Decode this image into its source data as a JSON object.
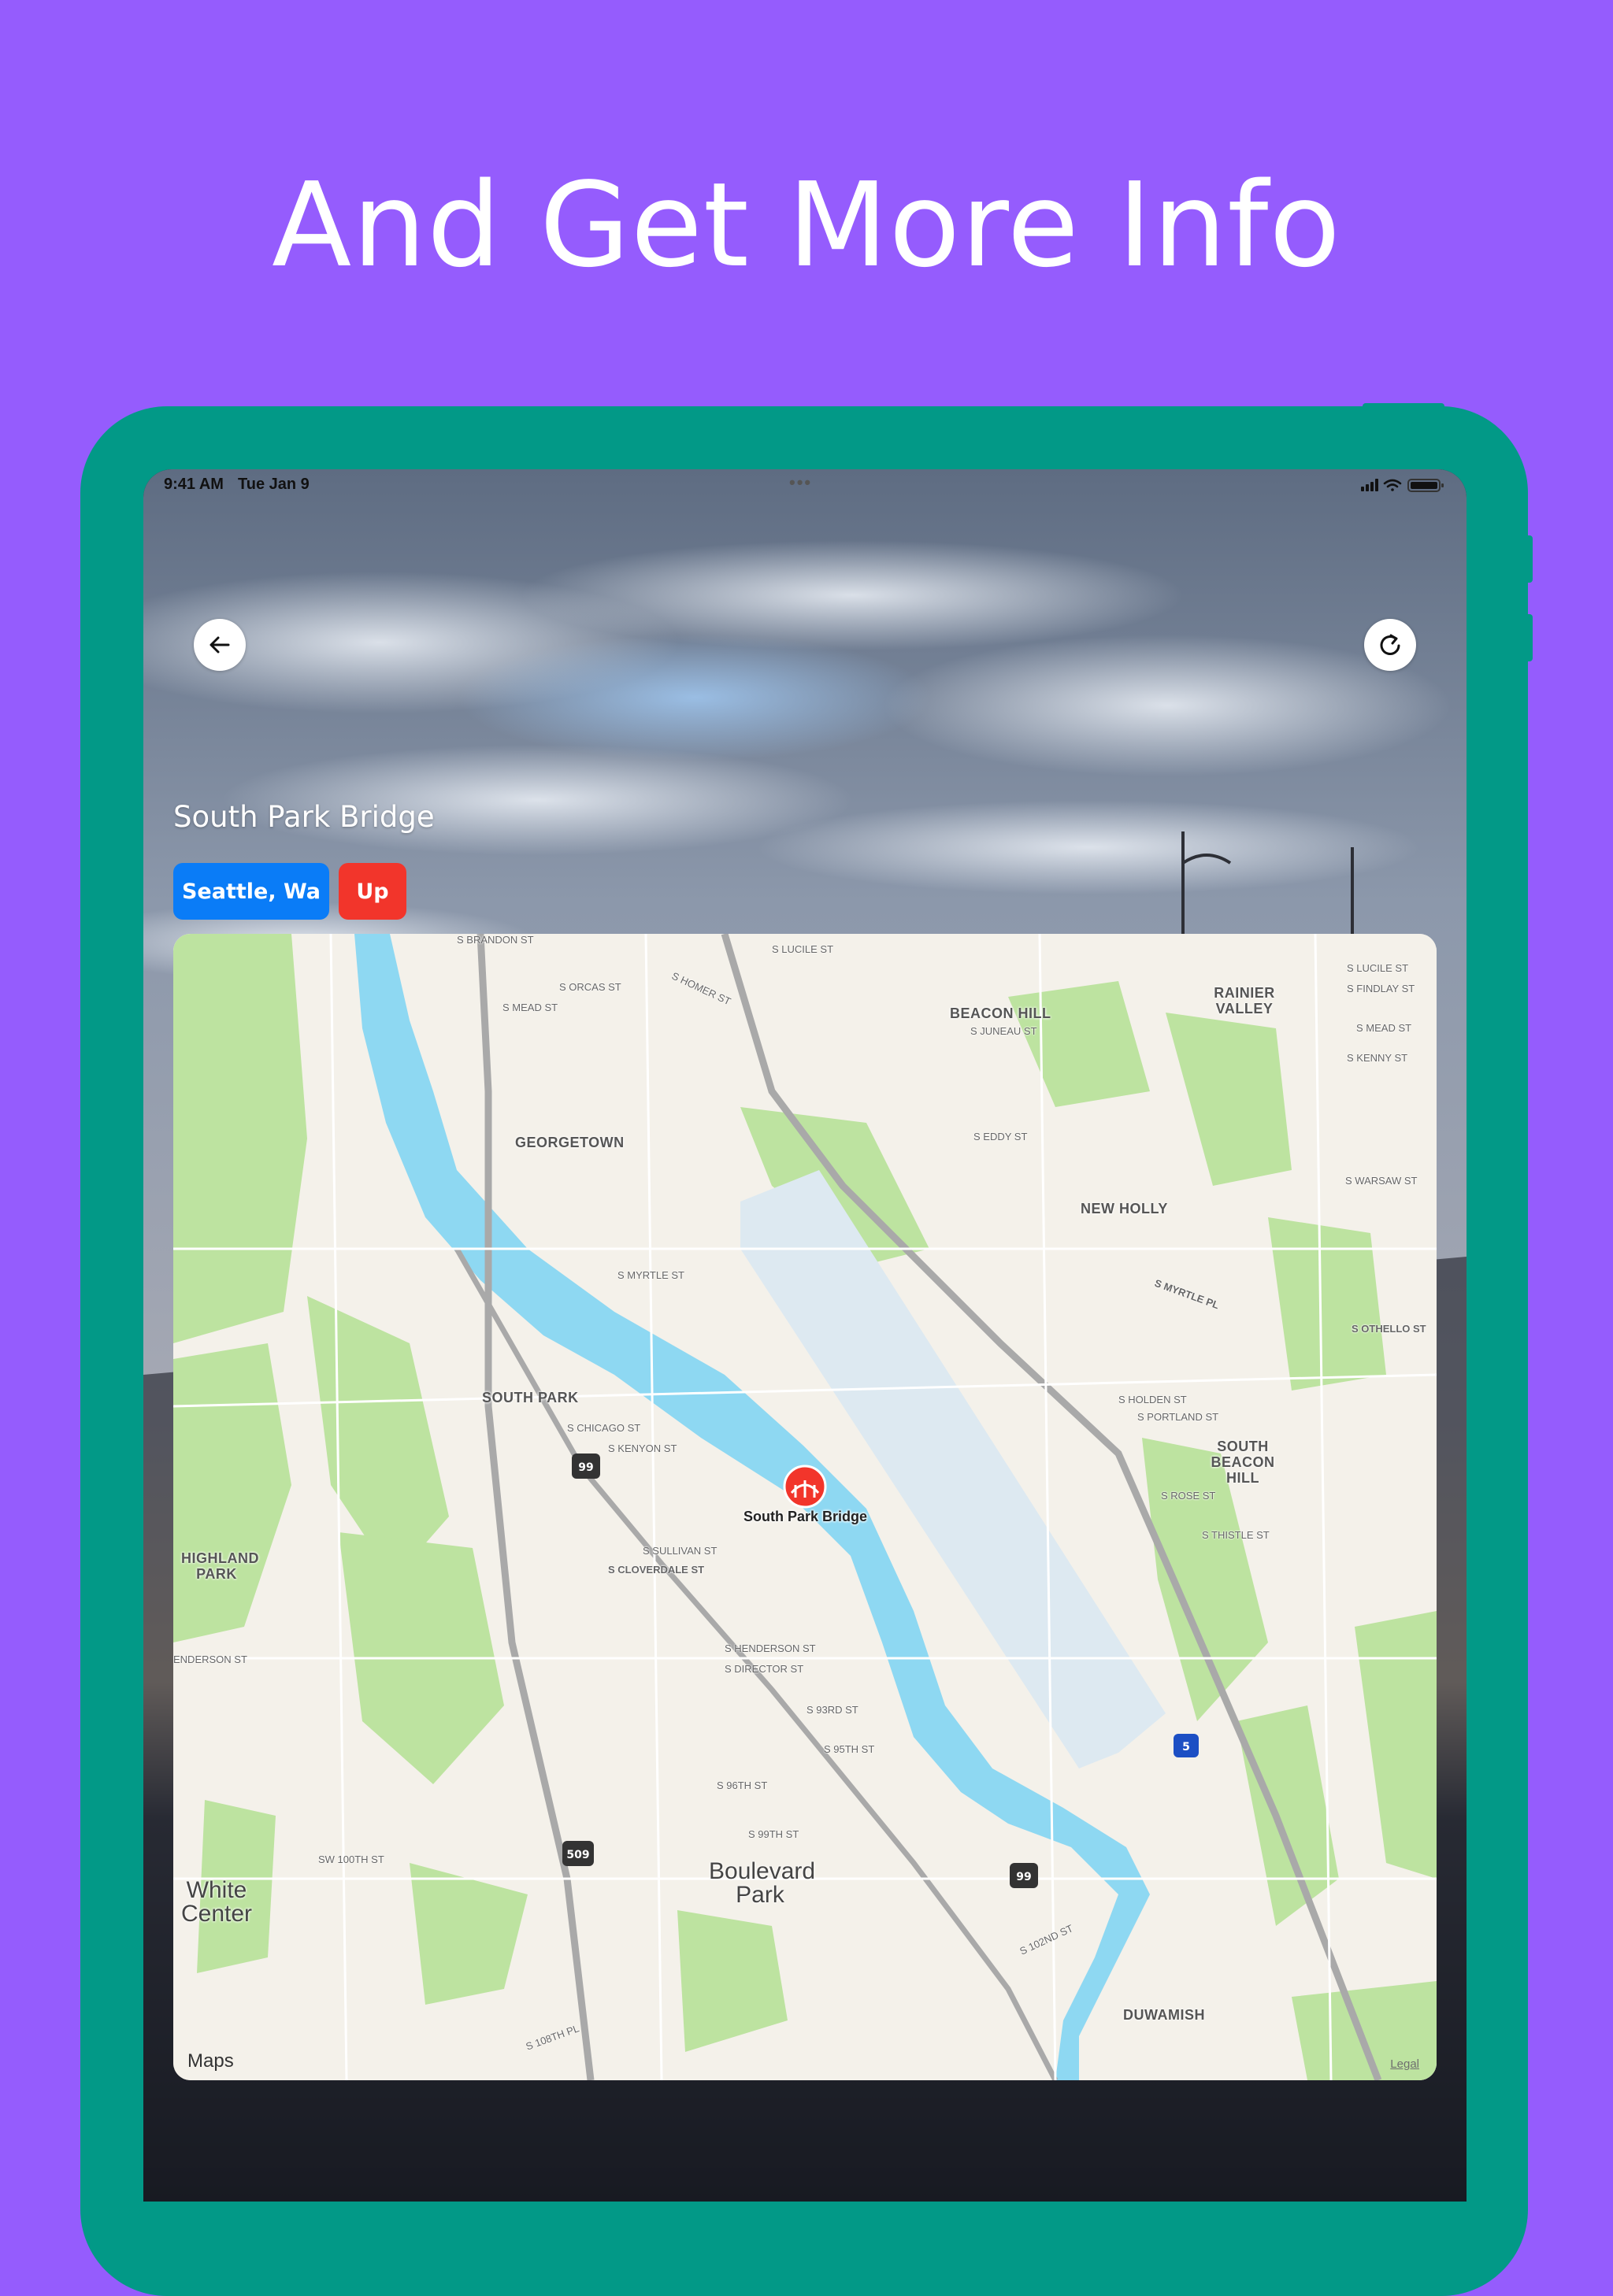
{
  "headline": "And Get More Info",
  "status_bar": {
    "time": "9:41 AM",
    "date": "Tue Jan 9"
  },
  "detail": {
    "title": "South Park Bridge",
    "chips": [
      {
        "label": "Seattle, Wa",
        "color": "#0a7cf7"
      },
      {
        "label": "Up",
        "color": "#f2352b"
      }
    ],
    "back_icon": "arrow-left-icon",
    "refresh_icon": "refresh-icon"
  },
  "map": {
    "pin_label": "South Park Bridge",
    "logo": " Maps",
    "legal": "Legal",
    "areas": [
      {
        "text": "GEORGETOWN"
      },
      {
        "text": "BEACON HILL"
      },
      {
        "text": "RAINIER VALLEY"
      },
      {
        "text": "NEW HOLLY"
      },
      {
        "text": "SOUTH PARK"
      },
      {
        "text": "SOUTH BEACON HILL"
      },
      {
        "text": "HIGHLAND PARK"
      },
      {
        "text": "DUWAMISH"
      }
    ],
    "big_places": [
      {
        "text": "Boulevard Park"
      },
      {
        "text": "White Center"
      }
    ],
    "streets": [
      "S BRANDON ST",
      "S LUCILE ST",
      "S LUCILE ST",
      "S FINDLAY ST",
      "S ORCAS ST",
      "S HOMER ST",
      "S MEAD ST",
      "S JUNEAU ST",
      "S MEAD ST",
      "S KENNY ST",
      "S EDDY ST",
      "S WARSAW ST",
      "S MYRTLE ST",
      "S MYRTLE PL",
      "S OTHELLO ST",
      "S HOLDEN ST",
      "S PORTLAND ST",
      "S CHICAGO ST",
      "S KENYON ST",
      "S ROSE ST",
      "S SULLIVAN ST",
      "S CLOVERDALE ST",
      "S THISTLE ST",
      "S HENDERSON ST",
      "S DIRECTOR ST",
      "S 93RD ST",
      "S 95TH ST",
      "S 96TH ST",
      "S 99TH ST",
      "SW 100TH ST",
      "S 102ND ST",
      "S 108TH PL",
      "ENDERSON ST"
    ],
    "highway_shields": [
      "99",
      "99",
      "509",
      "5"
    ]
  },
  "colors": {
    "background": "#955cfd",
    "device": "#029987",
    "water": "#8ed8f2",
    "park": "#bde3a0"
  }
}
